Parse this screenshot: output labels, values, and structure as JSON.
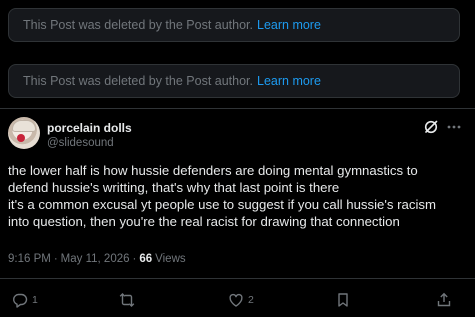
{
  "deleted_posts": [
    {
      "text": "This Post was deleted by the Post author.",
      "link": "Learn more"
    },
    {
      "text": "This Post was deleted by the Post author.",
      "link": "Learn more"
    }
  ],
  "post": {
    "display_name": "porcelain dolls",
    "handle": "@slidesound",
    "lines": [
      "the lower half is how hussie defenders are doing mental gymnastics to",
      "defend hussie's writting, that's why that last point is there",
      "it's a common excusal yt people use to suggest if you call hussie's racism",
      "into question, then you're the real racist for drawing that connection"
    ],
    "time": "9:16 PM",
    "date": "May 11, 2026",
    "views_count": "66",
    "views_label": "Views",
    "replies": "1",
    "reposts": "",
    "likes": "2"
  },
  "icons": {
    "grok": "grok-icon",
    "more": "more-icon",
    "reply": "reply-icon",
    "repost": "repost-icon",
    "like": "heart-icon",
    "bookmark": "bookmark-icon",
    "share": "share-icon"
  },
  "colors": {
    "background": "#000000",
    "card": "#16181c",
    "border": "#2f3336",
    "muted": "#71767b",
    "text": "#e7e9ea",
    "link": "#1d9bf0",
    "avatar_flower": "#c8243a"
  }
}
